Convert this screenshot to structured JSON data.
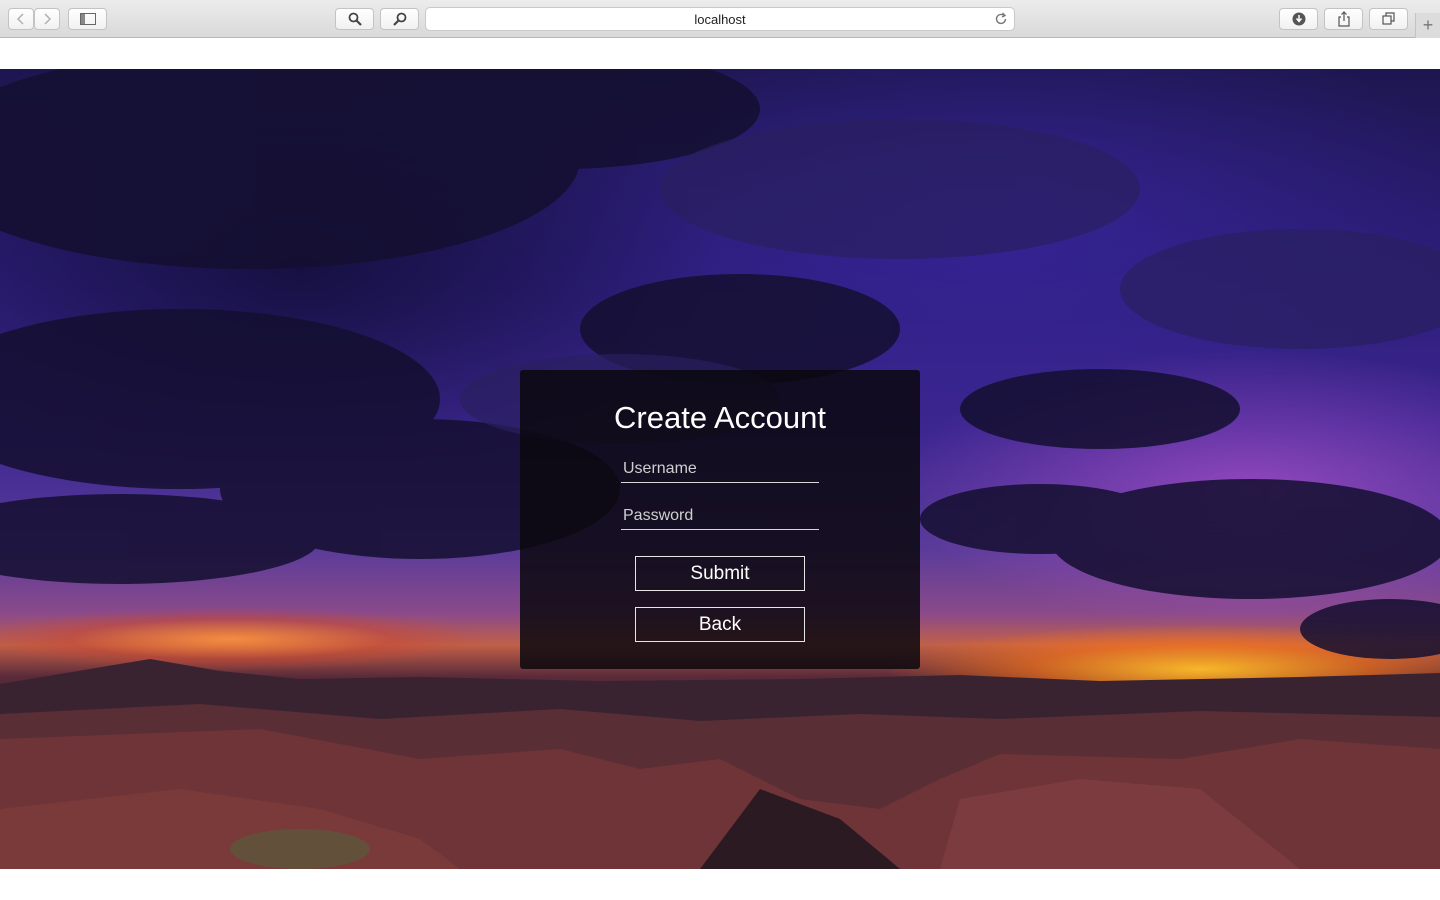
{
  "browser": {
    "url": "localhost",
    "icons": {
      "back": "chevron-left-icon",
      "forward": "chevron-right-icon",
      "sidebar": "sidebar-icon",
      "search": "magnifier-icon",
      "zoom": "zoom-icon",
      "reload": "reload-icon",
      "download": "download-icon",
      "share": "share-icon",
      "tabs": "tabs-icon",
      "new_tab": "plus-icon"
    }
  },
  "form": {
    "title": "Create Account",
    "username_placeholder": "Username",
    "password_placeholder": "Password",
    "submit_label": "Submit",
    "back_label": "Back"
  }
}
